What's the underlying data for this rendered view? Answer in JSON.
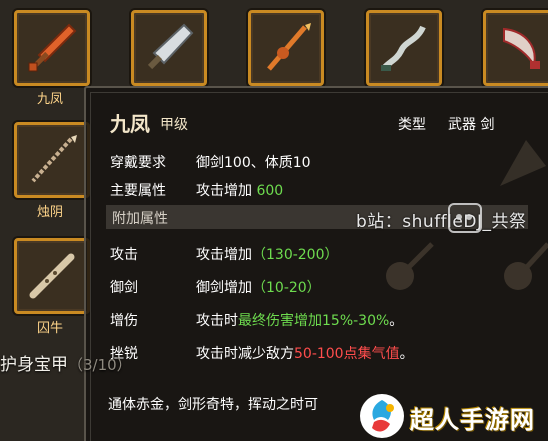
{
  "grid": {
    "items": [
      {
        "label": "九凤",
        "icon": "orange-sword-icon"
      },
      {
        "label": "",
        "icon": "silver-broadsword-icon"
      },
      {
        "label": "",
        "icon": "dragon-spear-icon"
      },
      {
        "label": "",
        "icon": "serpent-blade-icon"
      },
      {
        "label": "",
        "icon": "crimson-scimitar-icon"
      },
      {
        "label": "烛阴",
        "icon": "bone-spear-icon"
      },
      {
        "label": "囚牛",
        "icon": "bone-flute-icon"
      }
    ],
    "dim_labels": [
      "",
      "",
      "",
      "",
      ""
    ]
  },
  "tooltip": {
    "name": "九凤",
    "grade": "甲级",
    "type_label": "类型",
    "type_value": "武器 剑",
    "rows": [
      {
        "key": "穿戴要求",
        "value": "御剑100、体质10"
      },
      {
        "key": "主要属性",
        "value_prefix": "攻击增加 ",
        "value_highlight": "600"
      },
      {
        "key": "攻击",
        "value_prefix": "攻击增加",
        "value_highlight": "（130-200）"
      },
      {
        "key": "御剑",
        "value_prefix": "御剑增加",
        "value_highlight": "（10-20）"
      },
      {
        "key": "增伤",
        "value_prefix": "攻击时",
        "value_highlight": "最终伤害增加15%-30%",
        "value_suffix": "。"
      },
      {
        "key": "挫锐",
        "value_prefix": "攻击时减少敌方",
        "value_highlight": "50-100点集气值",
        "value_suffix": "。"
      }
    ],
    "section_header": "附加属性",
    "description": "通体赤金，剑形奇特，挥动之时可"
  },
  "watermark": "b站：shuffleDJ_共祭",
  "bottom_title": "护身宝甲",
  "bottom_count": "（3/10）",
  "logo": {
    "text": "超人手游网"
  },
  "colors": {
    "highlight_green": "#6edc4f",
    "highlight_red": "#ff4d4d",
    "slot_border": "#c98a22",
    "label_gold": "#ffd58a"
  }
}
